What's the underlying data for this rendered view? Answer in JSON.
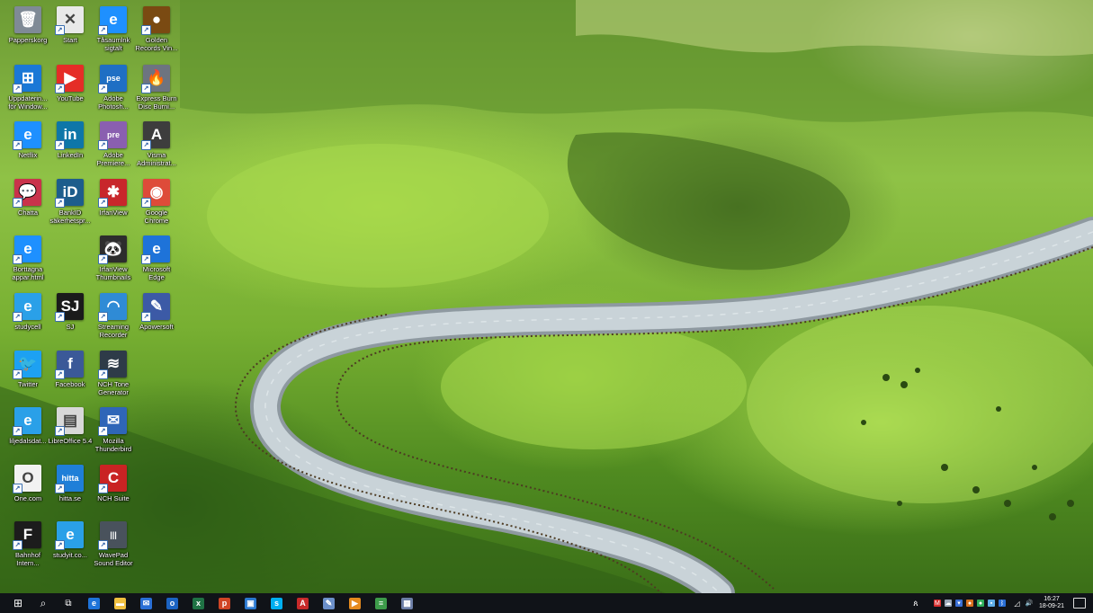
{
  "desktop": {
    "icons": [
      {
        "label": "Papperskorg",
        "glyph": "🗑",
        "color": "#7f8a96",
        "icon": "recycle-bin-icon"
      },
      {
        "label": "Start",
        "glyph": "✕",
        "color": "#e9e9e9",
        "icon": "start-shortcut-icon"
      },
      {
        "label": "Tåsaumlnk sigtalt",
        "glyph": "e",
        "color": "#1e90ff",
        "icon": "internet-explorer-icon"
      },
      {
        "label": "Golden Records Vin...",
        "glyph": "●",
        "color": "#7a4a12",
        "icon": "golden-records-icon"
      },
      {
        "label": "Uppdaterin... för Window...",
        "glyph": "⊞",
        "color": "#1a78d6",
        "icon": "windows-update-icon"
      },
      {
        "label": "YouTube",
        "glyph": "▶",
        "color": "#e52d27",
        "icon": "youtube-icon"
      },
      {
        "label": "Adobe Photosh...",
        "glyph": "pse",
        "color": "#1f6fc4",
        "icon": "photoshop-elements-icon"
      },
      {
        "label": "Express Burn Disc Burni...",
        "glyph": "🔥",
        "color": "#6d7480",
        "icon": "express-burn-icon"
      },
      {
        "label": "Netflix",
        "glyph": "e",
        "color": "#1e90ff",
        "icon": "netflix-ie-icon"
      },
      {
        "label": "LinkedIn",
        "glyph": "in",
        "color": "#0e76a8",
        "icon": "linkedin-icon"
      },
      {
        "label": "Adobe Premiere...",
        "glyph": "pre",
        "color": "#8a5fb0",
        "icon": "premiere-elements-icon"
      },
      {
        "label": "Visma Administrat...",
        "glyph": "A",
        "color": "#3d3d3d",
        "icon": "visma-icon"
      },
      {
        "label": "Chatta",
        "glyph": "💬",
        "color": "#c9334b",
        "icon": "chat-icon"
      },
      {
        "label": "BankID säkerhetspr...",
        "glyph": "iD",
        "color": "#1d5d8c",
        "icon": "bankid-icon"
      },
      {
        "label": "IrfanView",
        "glyph": "✱",
        "color": "#c8262b",
        "icon": "irfanview-icon"
      },
      {
        "label": "Google Chrome",
        "glyph": "◉",
        "color": "#de4b39",
        "icon": "chrome-icon"
      },
      {
        "label": "Borttagna appar.html",
        "glyph": "e",
        "color": "#1e90ff",
        "icon": "html-file-icon"
      },
      {
        "label": "IrfanView Thumbnails",
        "glyph": "🐼",
        "color": "#2d2d2d",
        "icon": "irfanview-thumbnails-icon"
      },
      {
        "label": "Microsoft Edge",
        "glyph": "e",
        "color": "#1e73d9",
        "icon": "edge-icon"
      },
      {
        "label": "studycell",
        "glyph": "e",
        "color": "#2aa0e8",
        "icon": "studycell-ie-icon"
      },
      {
        "label": "SJ",
        "glyph": "SJ",
        "color": "#1b1b1b",
        "icon": "sj-icon"
      },
      {
        "label": "Streaming Recorder",
        "glyph": "◠",
        "color": "#2f8bd6",
        "icon": "streaming-recorder-icon"
      },
      {
        "label": "Apowersoft",
        "glyph": "✎",
        "color": "#3c5aa6",
        "icon": "apowersoft-icon"
      },
      {
        "label": "Twitter",
        "glyph": "🐦",
        "color": "#1da1f2",
        "icon": "twitter-icon"
      },
      {
        "label": "Facebook",
        "glyph": "f",
        "color": "#3b5998",
        "icon": "facebook-icon"
      },
      {
        "label": "NCH Tone Generator",
        "glyph": "≋",
        "color": "#2e3b48",
        "icon": "nch-tone-generator-icon"
      },
      {
        "label": "liljedalsdat...",
        "glyph": "e",
        "color": "#2aa0e8",
        "icon": "liljedals-ie-icon"
      },
      {
        "label": "LibreOffice 5.4",
        "glyph": "▤",
        "color": "#d8d8d8",
        "icon": "libreoffice-icon"
      },
      {
        "label": "Mozilla Thunderbird",
        "glyph": "✉",
        "color": "#2f66b8",
        "icon": "thunderbird-icon"
      },
      {
        "label": "One.com",
        "glyph": "O",
        "color": "#f2f2f2",
        "icon": "one-com-icon"
      },
      {
        "label": "hitta.se",
        "glyph": "hitta",
        "color": "#1f7fd8",
        "icon": "hitta-icon"
      },
      {
        "label": "NCH Suite",
        "glyph": "C",
        "color": "#c92323",
        "icon": "nch-suite-icon"
      },
      {
        "label": "Bahnhof Intern...",
        "glyph": "F",
        "color": "#1c1c1c",
        "icon": "bahnhof-icon"
      },
      {
        "label": "studyit.co...",
        "glyph": "e",
        "color": "#2aa0e8",
        "icon": "studyit-ie-icon"
      },
      {
        "label": "WavePad Sound Editor",
        "glyph": "|||",
        "color": "#49525c",
        "icon": "wavepad-icon"
      }
    ]
  },
  "taskbar": {
    "start_glyph": "⊞",
    "search_glyph": "⌕",
    "taskview_glyph": "⧉",
    "apps": [
      {
        "icon": "edge-taskbar-icon",
        "color": "#1e73d9",
        "glyph": "e"
      },
      {
        "icon": "file-explorer-icon",
        "color": "#f0c040",
        "glyph": "▬"
      },
      {
        "icon": "mail-icon",
        "color": "#2a6fd6",
        "glyph": "✉"
      },
      {
        "icon": "outlook-icon",
        "color": "#1b63c2",
        "glyph": "o"
      },
      {
        "icon": "excel-icon",
        "color": "#1f7244",
        "glyph": "x"
      },
      {
        "icon": "powerpoint-icon",
        "color": "#d04525",
        "glyph": "p"
      },
      {
        "icon": "photos-icon",
        "color": "#2b79d0",
        "glyph": "▣"
      },
      {
        "icon": "skype-icon",
        "color": "#00aff0",
        "glyph": "s"
      },
      {
        "icon": "acrobat-icon",
        "color": "#c82a2a",
        "glyph": "A"
      },
      {
        "icon": "paint-icon",
        "color": "#6b8fc9",
        "glyph": "✎"
      },
      {
        "icon": "media-player-icon",
        "color": "#e58a1e",
        "glyph": "▶"
      },
      {
        "icon": "notepad-icon",
        "color": "#3d9b4a",
        "glyph": "≡"
      },
      {
        "icon": "calculator-icon",
        "color": "#6c7ea6",
        "glyph": "▦"
      }
    ],
    "tray": {
      "people_glyph": "ጰ",
      "icons": [
        {
          "icon": "antivirus-tray-icon",
          "color": "#d72c2c",
          "glyph": "M"
        },
        {
          "icon": "onedrive-tray-icon",
          "color": "#9aa7b8",
          "glyph": "☁"
        },
        {
          "icon": "shield-tray-icon",
          "color": "#3a6fd6",
          "glyph": "▾"
        },
        {
          "icon": "burn-tray-icon",
          "color": "#d8701e",
          "glyph": "●"
        },
        {
          "icon": "app-tray-icon",
          "color": "#2fae5a",
          "glyph": "●"
        },
        {
          "icon": "cloud-tray-icon",
          "color": "#5faee8",
          "glyph": "▪"
        },
        {
          "icon": "bluetooth-tray-icon",
          "color": "#2a6fd6",
          "glyph": "ᛒ"
        }
      ],
      "network_glyph": "◿",
      "volume_glyph": "🔊",
      "time": "16:27",
      "date": "18-09-21"
    }
  }
}
